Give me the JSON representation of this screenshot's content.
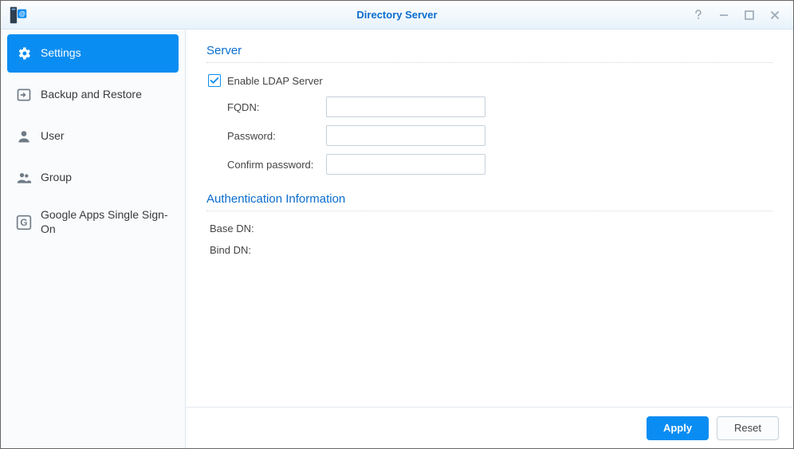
{
  "window": {
    "title": "Directory Server"
  },
  "sidebar": {
    "items": [
      {
        "label": "Settings",
        "icon": "gear-icon",
        "active": true
      },
      {
        "label": "Backup and Restore",
        "icon": "backup-icon",
        "active": false
      },
      {
        "label": "User",
        "icon": "user-icon",
        "active": false
      },
      {
        "label": "Group",
        "icon": "group-icon",
        "active": false
      },
      {
        "label": "Google Apps Single Sign-On",
        "icon": "google-icon",
        "active": false
      }
    ]
  },
  "main": {
    "server_section": {
      "heading": "Server",
      "enable_label": "Enable LDAP Server",
      "enable_checked": true,
      "fields": {
        "fqdn": {
          "label": "FQDN:",
          "value": ""
        },
        "password": {
          "label": "Password:",
          "value": ""
        },
        "confirm_password": {
          "label": "Confirm password:",
          "value": ""
        }
      }
    },
    "auth_section": {
      "heading": "Authentication Information",
      "base_dn": {
        "label": "Base DN:",
        "value": ""
      },
      "bind_dn": {
        "label": "Bind DN:",
        "value": ""
      }
    }
  },
  "footer": {
    "apply_label": "Apply",
    "reset_label": "Reset"
  }
}
